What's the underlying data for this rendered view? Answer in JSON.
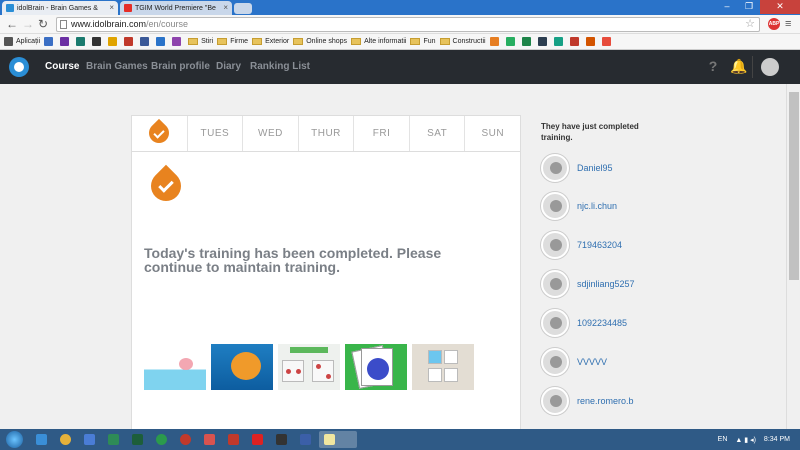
{
  "browser": {
    "tabs": [
      {
        "title": "idolBrain - Brain Games &",
        "active": true
      },
      {
        "title": "TGIM World Premiere \"Be",
        "active": false
      }
    ],
    "url_scheme": "www.idolbrain.com",
    "url_path": "/en/course",
    "abp_label": "ABP",
    "bookmarks": [
      {
        "label": "Aplicații",
        "type": "apps",
        "color": "#555"
      },
      {
        "label": "",
        "type": "site",
        "color": "#3b6fc4"
      },
      {
        "label": "",
        "type": "site",
        "color": "#6b2fa3"
      },
      {
        "label": "",
        "type": "site",
        "color": "#1a7a6e"
      },
      {
        "label": "",
        "type": "site",
        "color": "#333"
      },
      {
        "label": "",
        "type": "site",
        "color": "#e0a400"
      },
      {
        "label": "",
        "type": "site",
        "color": "#c0392b"
      },
      {
        "label": "",
        "type": "site",
        "color": "#3b5998"
      },
      {
        "label": "",
        "type": "site",
        "color": "#2a73c9"
      },
      {
        "label": "",
        "type": "site",
        "color": "#8e44ad"
      },
      {
        "label": "Stiri",
        "type": "folder"
      },
      {
        "label": "Firme",
        "type": "folder"
      },
      {
        "label": "Exterior",
        "type": "folder"
      },
      {
        "label": "Online shops",
        "type": "folder"
      },
      {
        "label": "Alte informatii",
        "type": "folder"
      },
      {
        "label": "Fun",
        "type": "folder"
      },
      {
        "label": "Constructii",
        "type": "folder"
      },
      {
        "label": "",
        "type": "site",
        "color": "#e67e22"
      },
      {
        "label": "",
        "type": "site",
        "color": "#27ae60"
      },
      {
        "label": "",
        "type": "site",
        "color": "#1e8449"
      },
      {
        "label": "",
        "type": "site",
        "color": "#2c3e50"
      },
      {
        "label": "",
        "type": "site",
        "color": "#16a085"
      },
      {
        "label": "",
        "type": "site",
        "color": "#c0392b"
      },
      {
        "label": "",
        "type": "site",
        "color": "#d35400"
      },
      {
        "label": "",
        "type": "site",
        "color": "#e74c3c"
      }
    ]
  },
  "site": {
    "nav": [
      {
        "label": "Course",
        "active": true
      },
      {
        "label": "Brain Games",
        "active": false
      },
      {
        "label": "Brain profile",
        "active": false
      },
      {
        "label": "Diary",
        "active": false
      },
      {
        "label": "Ranking List",
        "active": false
      }
    ],
    "help_label": "?"
  },
  "week": {
    "days": [
      "",
      "TUES",
      "WED",
      "THUR",
      "FRI",
      "SAT",
      "SUN"
    ],
    "completed_icon": "flame-check-icon"
  },
  "main": {
    "message": "Today's training has been completed. Please continue to maintain training.",
    "games": [
      "balloon-game",
      "fish-game",
      "dice-game",
      "cards-game",
      "puzzle-game"
    ]
  },
  "sidebar": {
    "title": "They have just completed training.",
    "users": [
      "Daniel95",
      "njc.li.chun",
      "719463204",
      "sdjinliang5257",
      "1092234485",
      "VVVVV",
      "rene.romero.b"
    ]
  },
  "taskbar": {
    "lang": "EN",
    "time": "8:34 PM"
  }
}
